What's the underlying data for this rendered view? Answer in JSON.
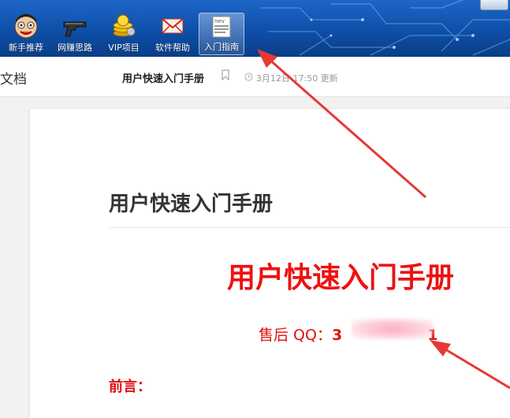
{
  "toolbar": {
    "items": [
      {
        "label": "新手推荐",
        "icon": "cartoon-face-icon"
      },
      {
        "label": "网赚思路",
        "icon": "pistol-icon"
      },
      {
        "label": "VIP项目",
        "icon": "gold-coins-icon"
      },
      {
        "label": "软件帮助",
        "icon": "envelope-icon"
      },
      {
        "label": "入门指南",
        "icon": "newspaper-icon"
      }
    ],
    "active_index": 4
  },
  "doc_header": {
    "prefix": "文档",
    "title": "用户快速入门手册",
    "meta": "3月12日 17:50 更新"
  },
  "document": {
    "heading": "用户快速入门手册",
    "big_title": "用户快速入门手册",
    "qq_label": "售后 QQ：",
    "qq_visible_start": "3",
    "qq_visible_end": "1",
    "preface": "前言："
  },
  "colors": {
    "toolbar_blue": "#1d66c8",
    "title_red": "#ee1111",
    "arrow_red": "#e53935"
  }
}
